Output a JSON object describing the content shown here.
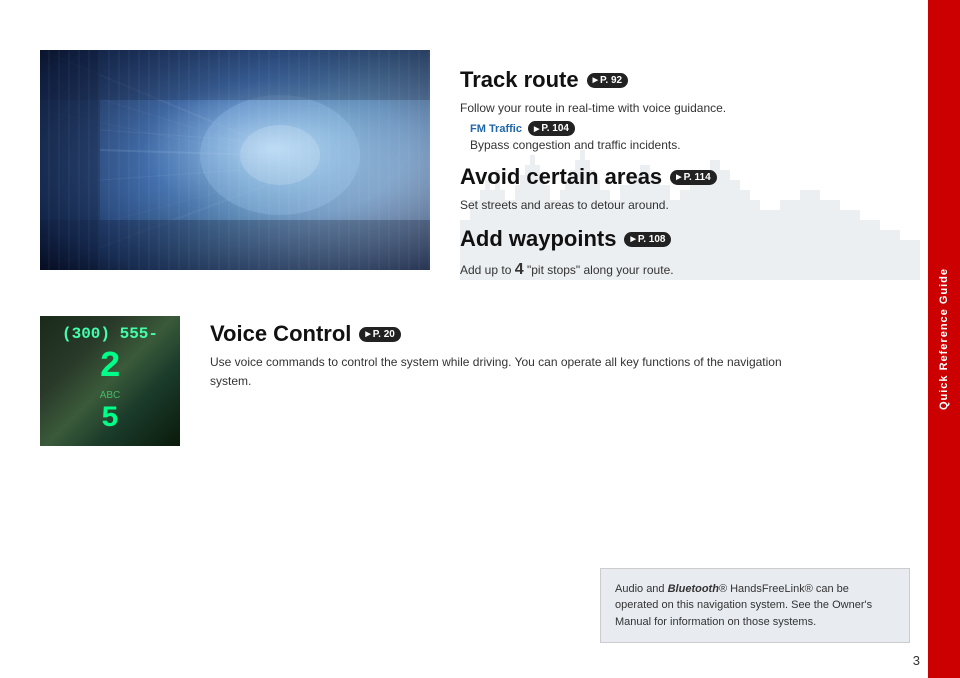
{
  "sidebar": {
    "label": "Quick Reference Guide",
    "color": "#cc0000"
  },
  "track_route": {
    "heading": "Track route",
    "page_ref": "P. 92",
    "description": "Follow your route in real-time with voice guidance.",
    "fm_traffic": {
      "label": "FM Traffic",
      "page_ref": "P. 104",
      "description": "Bypass congestion and traffic incidents."
    }
  },
  "avoid_areas": {
    "heading": "Avoid certain areas",
    "page_ref": "P. 114",
    "description": "Set streets and areas to detour around."
  },
  "add_waypoints": {
    "heading": "Add waypoints",
    "page_ref": "P. 108",
    "description": "Add up to",
    "number": "4",
    "description2": "\"pit stops\" along your route."
  },
  "voice_control": {
    "heading": "Voice Control",
    "page_ref": "P. 20",
    "description": "Use voice commands to control the system while driving. You can operate all key functions of the navigation system.",
    "phone_display_line1": "(300) 555-",
    "phone_display_line2": "2",
    "phone_display_sub": "ABC",
    "phone_display_line3": "5"
  },
  "info_box": {
    "text_part1": "Audio and ",
    "text_bold_italic": "Bluetooth",
    "text_part2": "® HandsFreeLink® can be operated on this navigation system. See the Owner's Manual for information on those systems."
  },
  "page_number": "3"
}
